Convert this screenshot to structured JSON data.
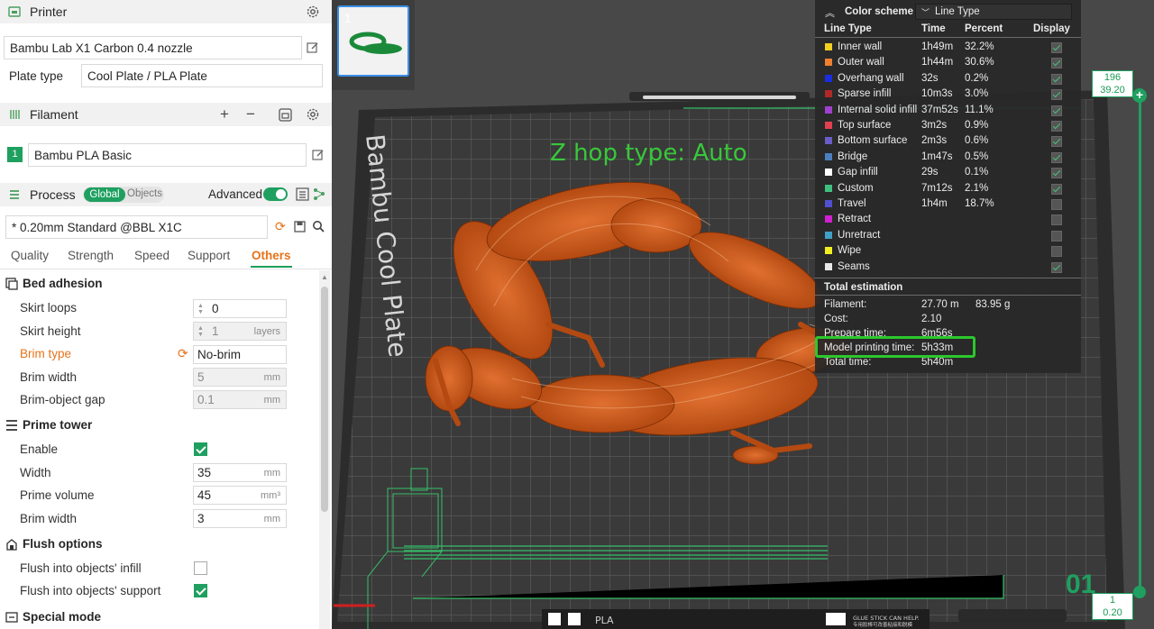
{
  "printer": {
    "title": "Printer",
    "name": "Bambu Lab X1 Carbon 0.4 nozzle",
    "plate_type_label": "Plate type",
    "plate_type_value": "Cool Plate / PLA Plate"
  },
  "filament": {
    "title": "Filament",
    "slot": "1",
    "name": "Bambu PLA Basic"
  },
  "process": {
    "title": "Process",
    "toggle_global": "Global",
    "toggle_objects": "Objects",
    "advanced_label": "Advanced",
    "preset": "* 0.20mm Standard @BBL X1C"
  },
  "tabs": [
    "Quality",
    "Strength",
    "Speed",
    "Support",
    "Others"
  ],
  "bed_adhesion": {
    "title": "Bed adhesion",
    "skirt_loops_label": "Skirt loops",
    "skirt_loops_value": "0",
    "skirt_height_label": "Skirt height",
    "skirt_height_value": "1",
    "skirt_height_unit": "layers",
    "brim_type_label": "Brim type",
    "brim_type_value": "No-brim",
    "brim_width_label": "Brim width",
    "brim_width_value": "5",
    "brim_width_unit": "mm",
    "brim_gap_label": "Brim-object gap",
    "brim_gap_value": "0.1",
    "brim_gap_unit": "mm"
  },
  "prime_tower": {
    "title": "Prime tower",
    "enable_label": "Enable",
    "width_label": "Width",
    "width_value": "35",
    "width_unit": "mm",
    "volume_label": "Prime volume",
    "volume_value": "45",
    "volume_unit": "mm³",
    "brim_width_label": "Brim width",
    "brim_width_value": "3",
    "brim_width_unit": "mm"
  },
  "flush_options": {
    "title": "Flush options",
    "infill_label": "Flush into objects' infill",
    "support_label": "Flush into objects' support"
  },
  "special_mode": {
    "title": "Special mode"
  },
  "viewport": {
    "plate_number": "1",
    "overlay_text": "Z hop type: Auto",
    "plate_label": "Bambu Cool Plate",
    "bottom_label": "PLA",
    "bottom_note": "GLUE STICK CAN HELP.",
    "bottom_note_cn": "专用胶棒可改善粘接和脱模"
  },
  "legend": {
    "color_scheme_label": "Color scheme",
    "scheme_value": "Line Type",
    "col_line_type": "Line Type",
    "col_time": "Time",
    "col_percent": "Percent",
    "col_display": "Display",
    "rows": [
      {
        "name": "Inner wall",
        "time": "1h49m",
        "percent": "32.2%",
        "color": "#f0d020",
        "on": true
      },
      {
        "name": "Outer wall",
        "time": "1h44m",
        "percent": "30.6%",
        "color": "#f08030",
        "on": true
      },
      {
        "name": "Overhang wall",
        "time": "32s",
        "percent": "0.2%",
        "color": "#1a2de0",
        "on": true
      },
      {
        "name": "Sparse infill",
        "time": "10m3s",
        "percent": "3.0%",
        "color": "#b02828",
        "on": true
      },
      {
        "name": "Internal solid infill",
        "time": "37m52s",
        "percent": "11.1%",
        "color": "#a040d0",
        "on": true
      },
      {
        "name": "Top surface",
        "time": "3m2s",
        "percent": "0.9%",
        "color": "#e04050",
        "on": true
      },
      {
        "name": "Bottom surface",
        "time": "2m3s",
        "percent": "0.6%",
        "color": "#6c5cc8",
        "on": true
      },
      {
        "name": "Bridge",
        "time": "1m47s",
        "percent": "0.5%",
        "color": "#4a80c0",
        "on": true
      },
      {
        "name": "Gap infill",
        "time": "29s",
        "percent": "0.1%",
        "color": "#ffffff",
        "on": true
      },
      {
        "name": "Custom",
        "time": "7m12s",
        "percent": "2.1%",
        "color": "#40c080",
        "on": true
      },
      {
        "name": "Travel",
        "time": "1h4m",
        "percent": "18.7%",
        "color": "#5050d0",
        "on": false
      },
      {
        "name": "Retract",
        "time": "",
        "percent": "",
        "color": "#d020d0",
        "on": false
      },
      {
        "name": "Unretract",
        "time": "",
        "percent": "",
        "color": "#40a0c8",
        "on": false
      },
      {
        "name": "Wipe",
        "time": "",
        "percent": "",
        "color": "#f0f020",
        "on": false
      },
      {
        "name": "Seams",
        "time": "",
        "percent": "",
        "color": "#e8e8e8",
        "on": true
      }
    ],
    "total_estimation": "Total estimation",
    "filament_label": "Filament:",
    "filament_length": "27.70 m",
    "filament_weight": "83.95 g",
    "cost_label": "Cost:",
    "cost_value": "2.10",
    "prepare_label": "Prepare time:",
    "prepare_value": "6m56s",
    "model_time_label": "Model printing time:",
    "model_time_value": "5h33m",
    "total_label": "Total time:",
    "total_value": "5h40m"
  },
  "slider": {
    "top_layer": "196",
    "top_height": "39.20",
    "bottom_layer": "1",
    "bottom_height": "0.20",
    "big_label": "01"
  },
  "colors": {
    "accent_green": "#1fa060",
    "changed_orange": "#e7731a",
    "model_orange": "#d4601a",
    "highlight_green": "#2dc72d"
  }
}
